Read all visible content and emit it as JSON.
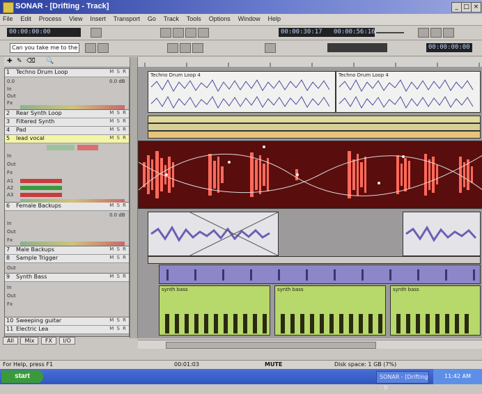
{
  "window": {
    "title": "SONAR - [Drifting - Track]"
  },
  "menu": [
    "File",
    "Edit",
    "Process",
    "View",
    "Insert",
    "Transport",
    "Go",
    "Track",
    "Tools",
    "Options",
    "Window",
    "Help"
  ],
  "toolbar": {
    "marker_field": "Can you take me to the",
    "time_display_1": "00:00:30:17",
    "time_display_2": "00:00:56:16",
    "time_display_3": "00:00:00:00"
  },
  "tracks": [
    {
      "num": "1",
      "name": "Techno Drum Loop",
      "color": "#e7e6e6"
    },
    {
      "num": "2",
      "name": "Rear Synth Loop",
      "color": "#e7e6e6"
    },
    {
      "num": "3",
      "name": "Filtered Synth",
      "color": "#e7e6e6"
    },
    {
      "num": "4",
      "name": "Pad",
      "color": "#e7e6e6"
    },
    {
      "num": "5",
      "name": "lead vocal",
      "color": "#f4f4a8"
    },
    {
      "num": "6",
      "name": "Female Backups",
      "color": "#e7e6e6"
    },
    {
      "num": "7",
      "name": "Male Backups",
      "color": "#e7e6e6"
    },
    {
      "num": "8",
      "name": "Sample Trigger",
      "color": "#e7e6e6"
    },
    {
      "num": "9",
      "name": "Synth Bass",
      "color": "#e7e6e6"
    },
    {
      "num": "10",
      "name": "Sweeping guitar",
      "color": "#e7e6e6"
    },
    {
      "num": "11",
      "name": "Electric Lea",
      "color": "#e7e6e6"
    }
  ],
  "track_fields": {
    "in": "In",
    "out": "Out",
    "fx": "Fx",
    "val1": "0.0",
    "val2": "0.0 dB",
    "a1": "A1",
    "a2": "A2",
    "a3": "A3"
  },
  "clips": {
    "drum_1": "Techno Drum Loop 4",
    "drum_2": "Techno Drum Loop 4",
    "synth_1": "synth bass",
    "synth_2": "synth bass",
    "synth_3": "synth bass"
  },
  "tabs": [
    "All",
    "Mix",
    "FX",
    "I/O"
  ],
  "status": {
    "help": "For Help, press F1",
    "pos": "00:01:03",
    "mute": "MUTE",
    "disk": "Disk space: 1 GB (7%)"
  },
  "taskbar": {
    "start": "start",
    "task_label": "SONAR - [Drifting - Tr",
    "clock": "11:42 AM"
  },
  "colors": {
    "title_bar": "#2b3fa0",
    "vocal_bg": "#5a0d0d",
    "vocal_wave": "#ff6a5a",
    "synth_clip": "#b7d86a",
    "perc_clip": "#8d86c8",
    "drum_clip": "#f1f1f0"
  }
}
